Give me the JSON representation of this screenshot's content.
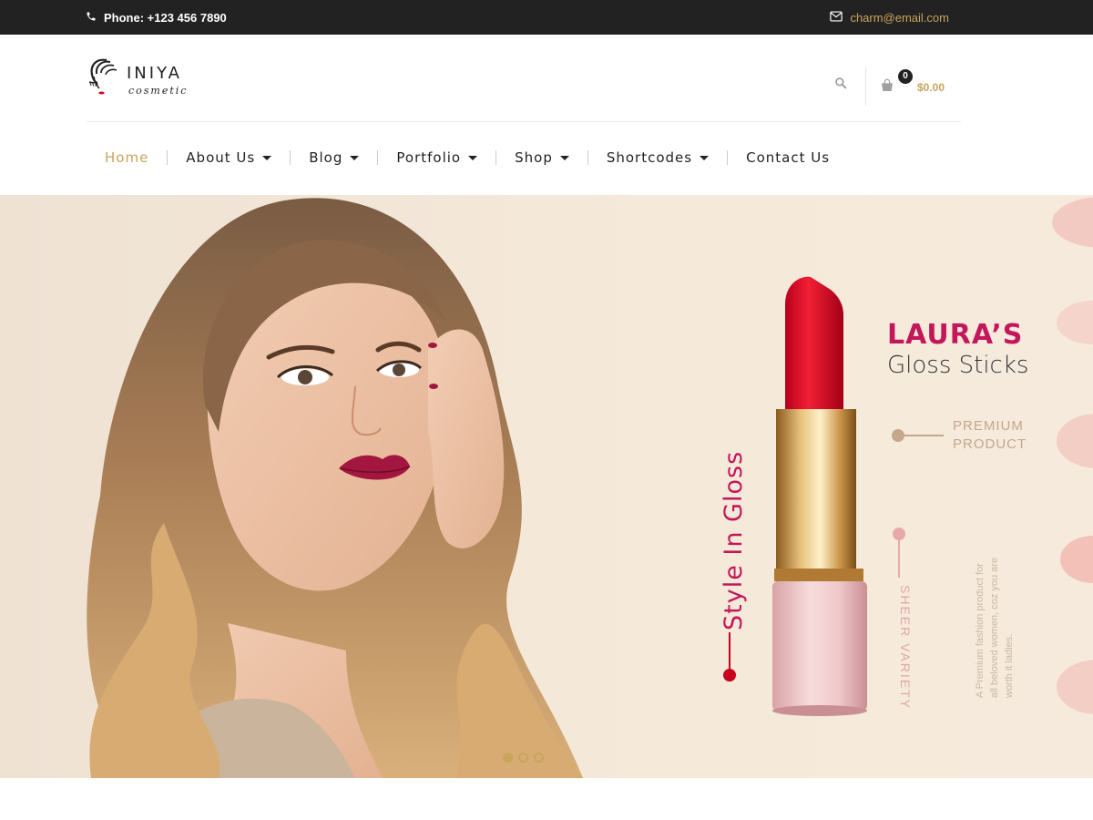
{
  "topbar": {
    "phone_label": "Phone: +123 456 7890",
    "email": "charm@email.com"
  },
  "logo": {
    "brand": "INIYA",
    "tagline": "cosmetic"
  },
  "cart": {
    "count": "0",
    "total": "$0.00"
  },
  "nav": {
    "items": [
      {
        "label": "Home",
        "active": true
      },
      {
        "label": "About Us",
        "dropdown": true
      },
      {
        "label": "Blog",
        "dropdown": true
      },
      {
        "label": "Portfolio",
        "dropdown": true
      },
      {
        "label": "Shop",
        "dropdown": true
      },
      {
        "label": "Shortcodes",
        "dropdown": true
      },
      {
        "label": "Contact Us"
      }
    ]
  },
  "hero": {
    "title_top": "LAURA’S",
    "title_bottom": "Gloss Sticks",
    "badge": "PREMIUM PRODUCT",
    "vertical_tagline": "Style In Gloss",
    "side_label": "SHEER VARIETY",
    "description": "A Premium fashion product for all beloved women, coz you are worth it ladies.",
    "slides": 3,
    "active_slide": 1
  },
  "colors": {
    "accent_gold": "#c9a45c",
    "brand_magenta": "#c2185b",
    "topbar_bg": "#222222",
    "hero_bg": "#f5e8d8"
  },
  "icons": [
    "phone-icon",
    "envelope-icon",
    "search-icon",
    "shopping-bag-icon",
    "chevron-down-icon"
  ]
}
